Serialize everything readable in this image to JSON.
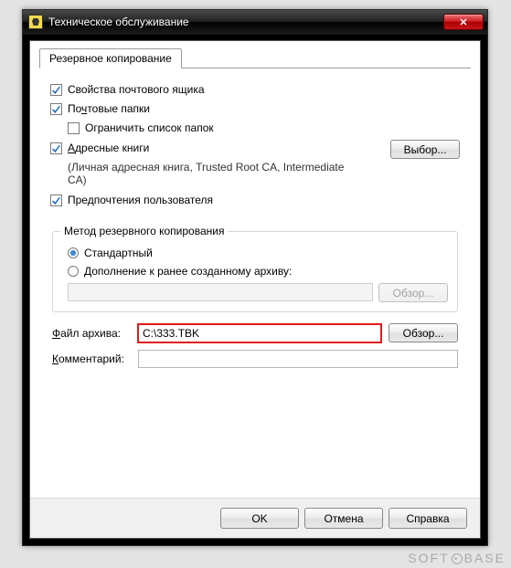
{
  "window": {
    "title": "Техническое обслуживание",
    "close": "✕"
  },
  "tab": {
    "label": "Резервное копирование"
  },
  "opts": {
    "mailbox_props": {
      "label": "Свойства почтового ящика",
      "checked": true
    },
    "mail_folders": {
      "label": "Почтовые папки",
      "checked": true
    },
    "limit_folders": {
      "label": "Ограничить список папок",
      "checked": false
    },
    "address_books": {
      "label": "Адресные книги",
      "checked": true,
      "hint": "(Личная адресная книга, Trusted Root CA, Intermediate CA)"
    },
    "user_prefs": {
      "label": "Предпочтения пользователя",
      "checked": true
    },
    "select_btn": "Выбор..."
  },
  "method": {
    "group_title": "Метод резервного копирования",
    "standard": "Стандартный",
    "append": "Дополнение к ранее созданному архиву:",
    "append_value": "",
    "browse": "Обзор..."
  },
  "archive": {
    "label": "Файл архива:",
    "value": "C:\\333.TBK",
    "browse": "Обзор..."
  },
  "comment": {
    "label": "Комментарий:",
    "value": ""
  },
  "buttons": {
    "ok": "OK",
    "cancel": "Отмена",
    "help": "Справка"
  },
  "watermark": "SOFT   BASE"
}
